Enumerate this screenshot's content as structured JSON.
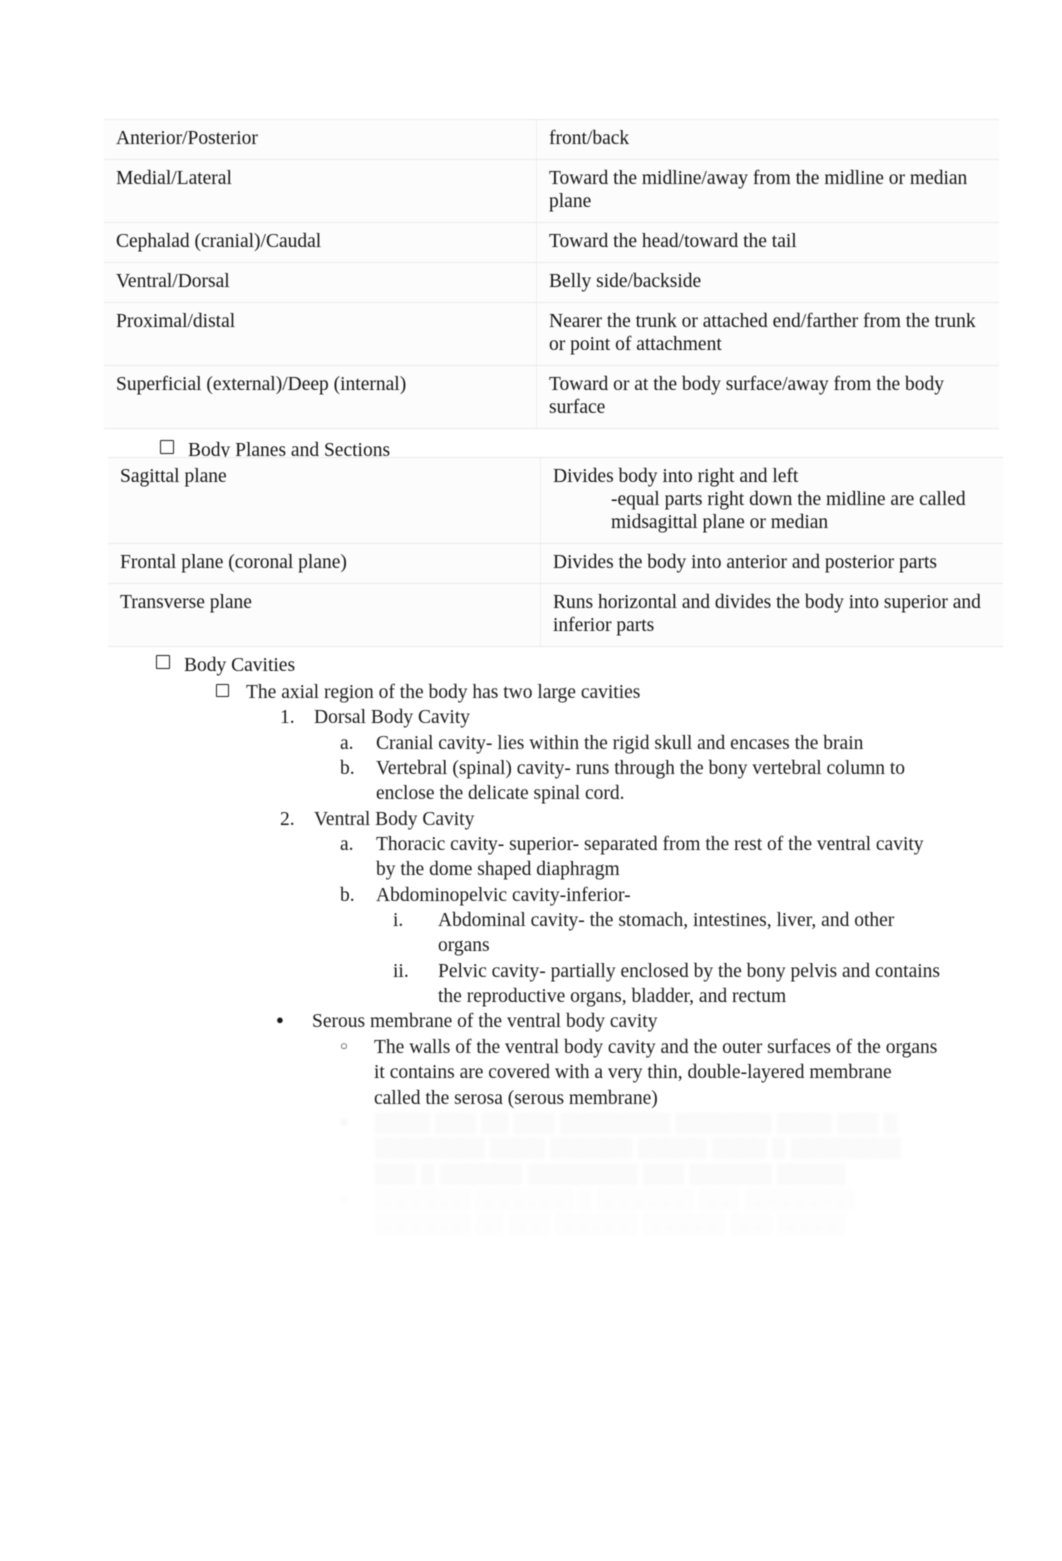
{
  "document": {
    "kind": "study-notes",
    "tables": [
      {
        "id": "directional-terms",
        "rows": [
          {
            "term": "Anterior/Posterior",
            "definition": "front/back"
          },
          {
            "term": "Medial/Lateral",
            "definition": "Toward the midline/away from the midline or median plane"
          },
          {
            "term": "Cephalad (cranial)/Caudal",
            "definition": "Toward the head/toward the tail"
          },
          {
            "term": "Ventral/Dorsal",
            "definition": "Belly side/backside"
          },
          {
            "term": "Proximal/distal",
            "definition": "Nearer the trunk or attached end/farther from the trunk or point of attachment"
          },
          {
            "term": "Superficial (external)/Deep (internal)",
            "definition": "Toward or at the body surface/away from the body surface"
          }
        ]
      },
      {
        "id": "body-planes",
        "rows": [
          {
            "term": "Sagittal plane",
            "definition": "Divides body into right and left",
            "definition_indent": "-equal parts right down the midline are called midsagittal plane or median"
          },
          {
            "term": "Frontal plane (coronal plane)",
            "definition": "Divides the body into anterior and posterior parts",
            "definition_indent": ""
          },
          {
            "term": "Transverse plane",
            "definition": "Runs horizontal and divides the body into superior and inferior parts",
            "definition_indent": ""
          }
        ]
      }
    ],
    "headings": {
      "body_planes_and_sections": "Body Planes and Sections",
      "body_cavities": "Body Cavities"
    },
    "outline": [
      {
        "level": "cb2",
        "marker": "checkbox",
        "text": "The axial region of the body has two large cavities"
      },
      {
        "level": "num",
        "marker": "1.",
        "text": "Dorsal Body Cavity"
      },
      {
        "level": "alpha",
        "marker": "a.",
        "text": "Cranial cavity- lies within the rigid skull and encases the brain"
      },
      {
        "level": "alpha",
        "marker": "b.",
        "text": "Vertebral (spinal) cavity- runs through the bony vertebral column to enclose the delicate spinal cord."
      },
      {
        "level": "num",
        "marker": "2.",
        "text": "Ventral Body Cavity"
      },
      {
        "level": "alpha",
        "marker": "a.",
        "text": "Thoracic cavity- superior- separated from the rest of the ventral cavity by the dome shaped diaphragm"
      },
      {
        "level": "alpha",
        "marker": "b.",
        "text": "Abdominopelvic cavity-inferior-"
      },
      {
        "level": "roman",
        "marker": "i.",
        "text": "Abdominal cavity- the stomach, intestines, liver, and other organs"
      },
      {
        "level": "roman",
        "marker": "ii.",
        "text": "Pelvic cavity- partially enclosed by the bony pelvis and contains the reproductive organs, bladder, and rectum"
      },
      {
        "level": "bul",
        "marker": "bullet",
        "text": "Serous membrane of the ventral body cavity"
      },
      {
        "level": "cir",
        "marker": "circle",
        "text": "The walls of the ventral body cavity and the outer surfaces of the organs it contains are covered with a very thin, double-layered membrane called the serosa (serous membrane)"
      }
    ],
    "faded_blocks": [
      {
        "level": "cir",
        "marker": "circle",
        "legible": false,
        "text": "░░░░ ░░░ ░░ ░░░ ░░░░░░░░ ░░░░░░░ ░░░░ ░░░ ░ ░░░░░░░░ ░░░░ ░░░░░░ ░░░░░ ░░░░ ░ ░░░░░░░░ ░░░ ░ ░░░░░░ ░░░░░░░░ ░░░ ░░░░░░ ░░░░░"
      },
      {
        "level": "cir",
        "marker": "circle",
        "legible": false,
        "text": "░░░░░░░ ░░░░░░░ ░ ░░░░░░░ ░░░ ░░░░░░░░ ░░░░░░░ ░░ ░░░ ░░░░░░ ░░░░░░ ░░░ ░░░░░"
      }
    ]
  }
}
